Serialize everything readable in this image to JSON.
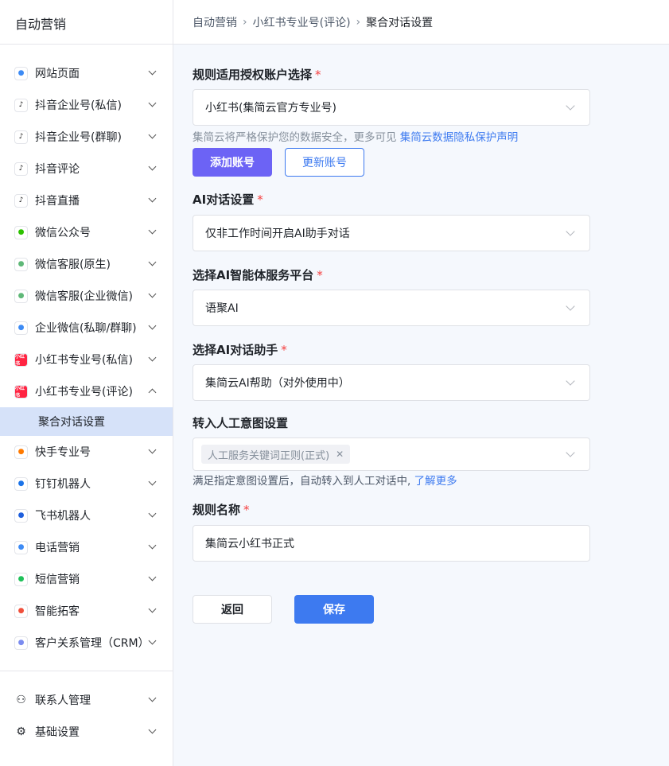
{
  "app_title": "自动营销",
  "breadcrumb": [
    "自动营销",
    "小红书专业号(评论)",
    "聚合对话设置"
  ],
  "sidebar": {
    "items": [
      {
        "label": "网站页面",
        "icon": "website-icon",
        "color": "#3d8bf5"
      },
      {
        "label": "抖音企业号(私信)",
        "icon": "douyin-icon",
        "color": "#111"
      },
      {
        "label": "抖音企业号(群聊)",
        "icon": "douyin-icon",
        "color": "#111"
      },
      {
        "label": "抖音评论",
        "icon": "douyin-icon",
        "color": "#111"
      },
      {
        "label": "抖音直播",
        "icon": "douyin-icon",
        "color": "#111"
      },
      {
        "label": "微信公众号",
        "icon": "wechat-icon",
        "color": "#2dc100"
      },
      {
        "label": "微信客服(原生)",
        "icon": "wechat-service-icon",
        "color": "#5fb878"
      },
      {
        "label": "微信客服(企业微信)",
        "icon": "wechat-service-icon",
        "color": "#5fb878"
      },
      {
        "label": "企业微信(私聊/群聊)",
        "icon": "wecom-icon",
        "color": "#3d8bf5"
      },
      {
        "label": "小红书专业号(私信)",
        "icon": "xiaohongshu-icon",
        "color": "#ff2442"
      },
      {
        "label": "小红书专业号(评论)",
        "icon": "xiaohongshu-icon",
        "color": "#ff2442",
        "expanded": true
      },
      {
        "label": "快手专业号",
        "icon": "kuaishou-icon",
        "color": "#ff7a00"
      },
      {
        "label": "钉钉机器人",
        "icon": "dingtalk-icon",
        "color": "#1a73e8"
      },
      {
        "label": "飞书机器人",
        "icon": "feishu-icon",
        "color": "#1f5fdd"
      },
      {
        "label": "电话营销",
        "icon": "phone-icon",
        "color": "#3d8bf5"
      },
      {
        "label": "短信营销",
        "icon": "sms-icon",
        "color": "#1fc15a"
      },
      {
        "label": "智能拓客",
        "icon": "target-icon",
        "color": "#f0503c"
      },
      {
        "label": "客户关系管理（CRM）",
        "icon": "funnel-icon",
        "color": "#7b8cf0"
      }
    ],
    "sub_item": "聚合对话设置",
    "bottom": [
      {
        "label": "联系人管理",
        "icon": "contacts-gear-icon"
      },
      {
        "label": "基础设置",
        "icon": "gear-icon"
      }
    ]
  },
  "form": {
    "account": {
      "label": "规则适用授权账户选择",
      "value": "小红书(集简云官方专业号)",
      "help": "集简云将严格保护您的数据安全，更多可见 ",
      "help_link": "集简云数据隐私保护声明",
      "add": "添加账号",
      "update": "更新账号"
    },
    "ai": {
      "label": "AI对话设置",
      "value": "仅非工作时间开启AI助手对话"
    },
    "platform": {
      "label": "选择AI智能体服务平台",
      "value": "语聚AI"
    },
    "assistant": {
      "label": "选择AI对话助手",
      "value": "集简云AI帮助（对外使用中）"
    },
    "intent": {
      "label": "转入人工意图设置",
      "tag": "人工服务关键词正则(正式)",
      "help": "满足指定意图设置后，自动转入到人工对话中,",
      "help_link": "了解更多"
    },
    "name": {
      "label": "规则名称",
      "value": "集简云小红书正式"
    },
    "back": "返回",
    "save": "保存",
    "required": "*"
  },
  "colors": {
    "primary": "#3d7af0",
    "add_button": "#6c63f5",
    "active_bg": "#d6e2f9",
    "required": "#f53f3f"
  }
}
